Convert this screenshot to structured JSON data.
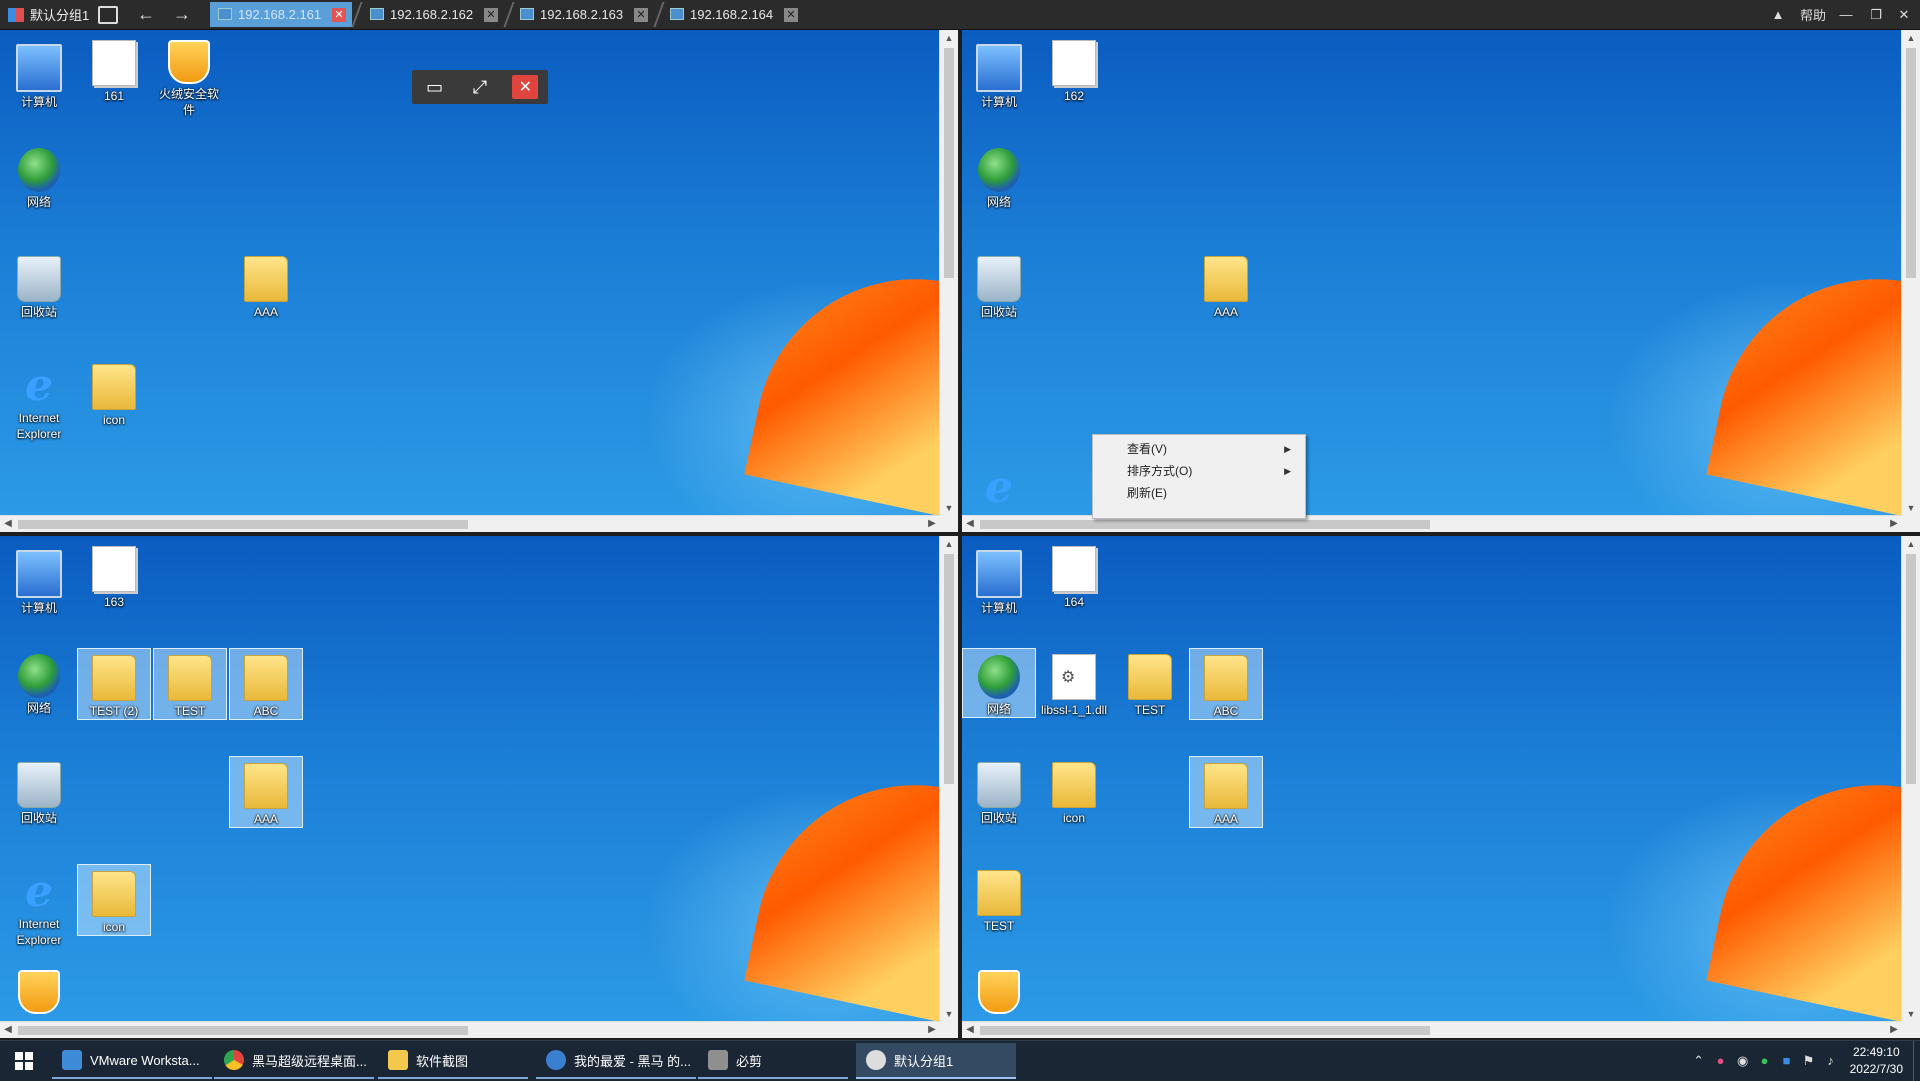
{
  "titlebar": {
    "group_label": "默认分组1",
    "help_label": "帮助",
    "tabs": [
      {
        "label": "192.168.2.161",
        "active": true
      },
      {
        "label": "192.168.2.162",
        "active": false
      },
      {
        "label": "192.168.2.163",
        "active": false
      },
      {
        "label": "192.168.2.164",
        "active": false
      }
    ]
  },
  "panes": [
    {
      "id": "pane-161",
      "icons": [
        {
          "label": "计算机",
          "type": "computer"
        },
        {
          "label": "161",
          "type": "doc"
        },
        {
          "label": "火绒安全软件",
          "type": "shield"
        },
        {
          "label": "网络",
          "type": "globe"
        },
        {
          "label": "回收站",
          "type": "bin"
        },
        {
          "label": "AAA",
          "type": "folder"
        },
        {
          "label": "Internet Explorer",
          "type": "ie"
        },
        {
          "label": "icon",
          "type": "folder"
        }
      ]
    },
    {
      "id": "pane-162",
      "icons": [
        {
          "label": "计算机",
          "type": "computer"
        },
        {
          "label": "162",
          "type": "doc"
        },
        {
          "label": "网络",
          "type": "globe"
        },
        {
          "label": "回收站",
          "type": "bin"
        },
        {
          "label": "AAA",
          "type": "folder"
        }
      ]
    },
    {
      "id": "pane-163",
      "icons": [
        {
          "label": "计算机",
          "type": "computer"
        },
        {
          "label": "163",
          "type": "doc"
        },
        {
          "label": "网络",
          "type": "globe"
        },
        {
          "label": "TEST (2)",
          "type": "folder"
        },
        {
          "label": "TEST",
          "type": "folder"
        },
        {
          "label": "ABC",
          "type": "folder"
        },
        {
          "label": "回收站",
          "type": "bin"
        },
        {
          "label": "AAA",
          "type": "folder"
        },
        {
          "label": "Internet Explorer",
          "type": "ie"
        },
        {
          "label": "icon",
          "type": "folder"
        }
      ]
    },
    {
      "id": "pane-164",
      "icons": [
        {
          "label": "计算机",
          "type": "computer"
        },
        {
          "label": "164",
          "type": "doc"
        },
        {
          "label": "网络",
          "type": "globe"
        },
        {
          "label": "libssl-1_1.dll",
          "type": "dll"
        },
        {
          "label": "TEST",
          "type": "folder"
        },
        {
          "label": "ABC",
          "type": "folder"
        },
        {
          "label": "回收站",
          "type": "bin"
        },
        {
          "label": "icon",
          "type": "folder"
        },
        {
          "label": "AAA",
          "type": "folder"
        },
        {
          "label": "TEST",
          "type": "folder"
        }
      ]
    }
  ],
  "context_menu": {
    "items": [
      {
        "label": "查看(V)",
        "submenu": true
      },
      {
        "label": "排序方式(O)",
        "submenu": true
      },
      {
        "label": "刷新(E)",
        "submenu": false
      }
    ]
  },
  "taskbar": {
    "items": [
      {
        "label": "VMware Worksta...",
        "color": "#3f8ad6"
      },
      {
        "label": "黑马超级远程桌面...",
        "color": "#e2453c"
      },
      {
        "label": "软件截图",
        "color": "#f2c94c"
      },
      {
        "label": "我的最爱 - 黑马 的...",
        "color": "#3a7fd0"
      },
      {
        "label": "必剪",
        "color": "#8f8f8f"
      },
      {
        "label": "默认分组1",
        "color": "#dddddd"
      }
    ],
    "clock_time": "22:49:10",
    "clock_date": "2022/7/30"
  }
}
